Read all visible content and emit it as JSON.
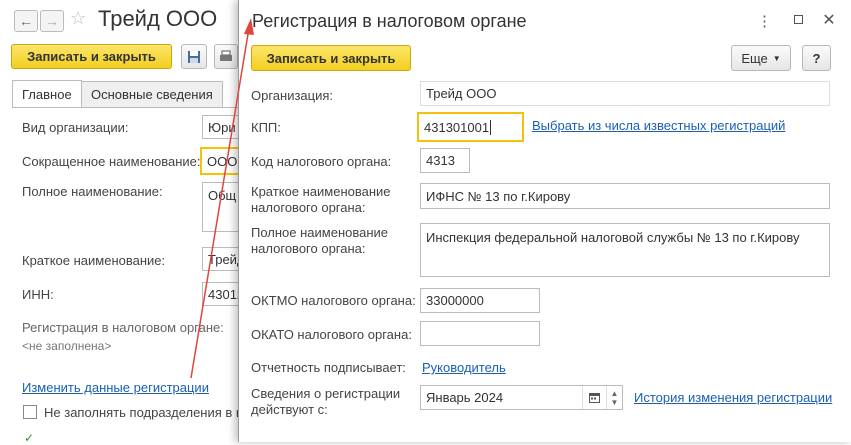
{
  "bg_window": {
    "title": "Трейд ООО",
    "save_close_label": "Записать и закрыть",
    "tabs": [
      {
        "label": "Главное"
      },
      {
        "label": "Основные сведения"
      }
    ],
    "fields": {
      "org_type_label": "Вид организации:",
      "org_type_value": "Юри",
      "short_name_label": "Сокращенное наименование:",
      "short_name_value": "ООО",
      "full_name_label": "Полное наименование:",
      "full_name_value": "Общ",
      "brief_name_label": "Краткое наименование:",
      "brief_name_value": "Трейд",
      "inn_label": "ИНН:",
      "inn_value": "43012"
    },
    "tax_reg_label": "Регистрация в налоговом органе:",
    "tax_reg_value": "<не заполнена>",
    "change_reg_link": "Изменить данные регистрации",
    "no_fill_subdivisions_label": "Не заполнять подразделения в н"
  },
  "dialog": {
    "title": "Регистрация в налоговом органе",
    "save_close_label": "Записать и закрыть",
    "more_label": "Еще",
    "help_label": "?",
    "org_label": "Организация:",
    "org_value": "Трейд ООО",
    "kpp_label": "КПП:",
    "kpp_value": "431301001",
    "choose_known_link": "Выбрать из числа известных регистраций",
    "tax_code_label": "Код налогового органа:",
    "tax_code_value": "4313",
    "short_tax_name_label_1": "Краткое наименование",
    "short_tax_name_label_2": "налогового органа:",
    "short_tax_name_value": "ИФНС № 13 по г.Кирову",
    "full_tax_name_label_1": "Полное наименование",
    "full_tax_name_label_2": "налогового органа:",
    "full_tax_name_value": "Инспекция федеральной налоговой службы № 13 по г.Кирову",
    "oktmo_label": "ОКТМО налогового органа:",
    "oktmo_value": "33000000",
    "okato_label": "ОКАТО налогового органа:",
    "okato_value": "",
    "signer_label": "Отчетность подписывает:",
    "signer_link": "Руководитель",
    "effective_label_1": "Сведения о регистрации",
    "effective_label_2": "действуют с:",
    "effective_value": "Январь 2024",
    "history_link": "История изменения регистрации"
  },
  "colors": {
    "accent_yellow": "#f3cf1e",
    "link_blue": "#1b5fb3",
    "annotation_arrow": "#e0463c"
  }
}
